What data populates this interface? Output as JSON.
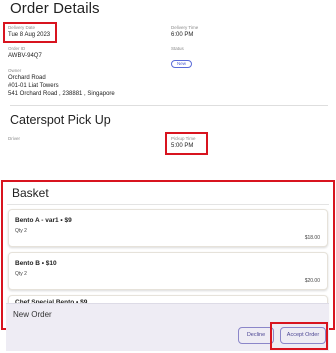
{
  "order": {
    "title": "Order Details",
    "delivery_date_label": "Delivery Date",
    "delivery_date_value": "Tue 8 Aug 2023",
    "delivery_time_label": "Delivery Time",
    "delivery_time_value": "6:00 PM",
    "order_id_label": "Order ID",
    "order_id_value": "AWBV-94Q7",
    "status_label": "Status",
    "status_value": "New",
    "owner_label": "Owner",
    "owner_name": "Orchard Road",
    "owner_address_1": "#01-01 Liat Towers",
    "owner_address_2": "541 Orchard Road , 238881 , Singapore"
  },
  "pickup": {
    "title": "Caterspot Pick Up",
    "driver_label": "Driver",
    "pickup_time_label": "Pickup Time",
    "pickup_time_value": "5:00 PM"
  },
  "basket": {
    "title": "Basket",
    "items": [
      {
        "name": "Bento A - var1 • $9",
        "qty": "Qty 2",
        "price": "$18.00"
      },
      {
        "name": "Bento B • $10",
        "qty": "Qty 2",
        "price": "$20.00"
      },
      {
        "name": "Chef Special Bento • $9"
      }
    ]
  },
  "new_order": {
    "title": "New Order",
    "decline_label": "Decline",
    "accept_label": "Accept Order"
  },
  "colors": {
    "highlight": "#d8141f",
    "button_border": "#8b86c9",
    "button_text": "#4b4593",
    "status_pill": "#4a5bd0",
    "panel_bg": "#eeecf4"
  }
}
